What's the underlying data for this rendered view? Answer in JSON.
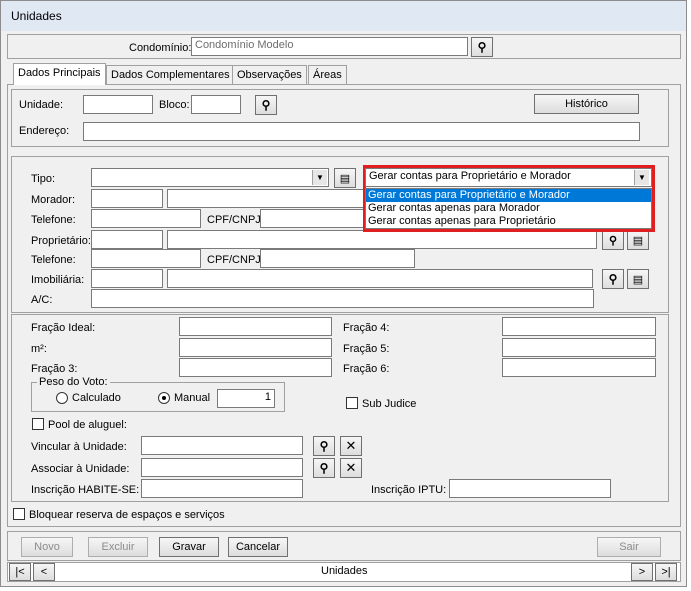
{
  "window": {
    "title": "Unidades"
  },
  "header": {
    "condominio_label": "Condomínio:",
    "condominio_value": "Condomínio Modelo"
  },
  "tabs": [
    {
      "label": "Dados Principais"
    },
    {
      "label": "Dados Complementares"
    },
    {
      "label": "Observações"
    },
    {
      "label": "Áreas"
    }
  ],
  "unit_section": {
    "unidade_label": "Unidade:",
    "unidade_value": "",
    "bloco_label": "Bloco:",
    "bloco_value": "",
    "historico_button": "Histórico",
    "endereco_label": "Endereço:",
    "endereco_value": ""
  },
  "people_section": {
    "tipo_label": "Tipo:",
    "tipo_value": "",
    "morador_label": "Morador:",
    "telefone_label": "Telefone:",
    "cpf_label": "CPF/CNPJ:",
    "proprietario_label": "Proprietário:",
    "telefone2_label": "Telefone:",
    "cpf2_label": "CPF/CNPJ:",
    "imobiliaria_label": "Imobiliária:",
    "ac_label": "A/C:"
  },
  "billing_dropdown": {
    "selected": "Gerar contas para Proprietário e Morador",
    "options": [
      "Gerar contas para Proprietário e Morador",
      "Gerar contas apenas para Morador",
      "Gerar contas apenas para Proprietário"
    ],
    "highlight_color": "#0078d7",
    "callout_color": "#e02020"
  },
  "fractions": {
    "fracao_ideal_label": "Fração Ideal:",
    "m2_label": "m²:",
    "fracao3_label": "Fração 3:",
    "fracao4_label": "Fração 4:",
    "fracao5_label": "Fração 5:",
    "fracao6_label": "Fração 6:"
  },
  "voto": {
    "group_label": "Peso do Voto:",
    "calculado_label": "Calculado",
    "manual_label": "Manual",
    "manual_value": "1",
    "selected": "Manual",
    "sub_judice_label": "Sub Judice"
  },
  "links": {
    "pool_label": "Pool de aluguel:",
    "vincular_label": "Vincular à Unidade:",
    "associar_label": "Associar à Unidade:",
    "habite_label": "Inscrição HABITE-SE:",
    "iptu_label": "Inscrição IPTU:"
  },
  "bloquear_label": "Bloquear reserva de espaços e serviços",
  "actions": {
    "novo": "Novo",
    "excluir": "Excluir",
    "gravar": "Gravar",
    "cancelar": "Cancelar",
    "sair": "Sair"
  },
  "navigator": {
    "first": "|<",
    "prev": "<",
    "label": "Unidades",
    "next": ">",
    "last": ">|"
  }
}
